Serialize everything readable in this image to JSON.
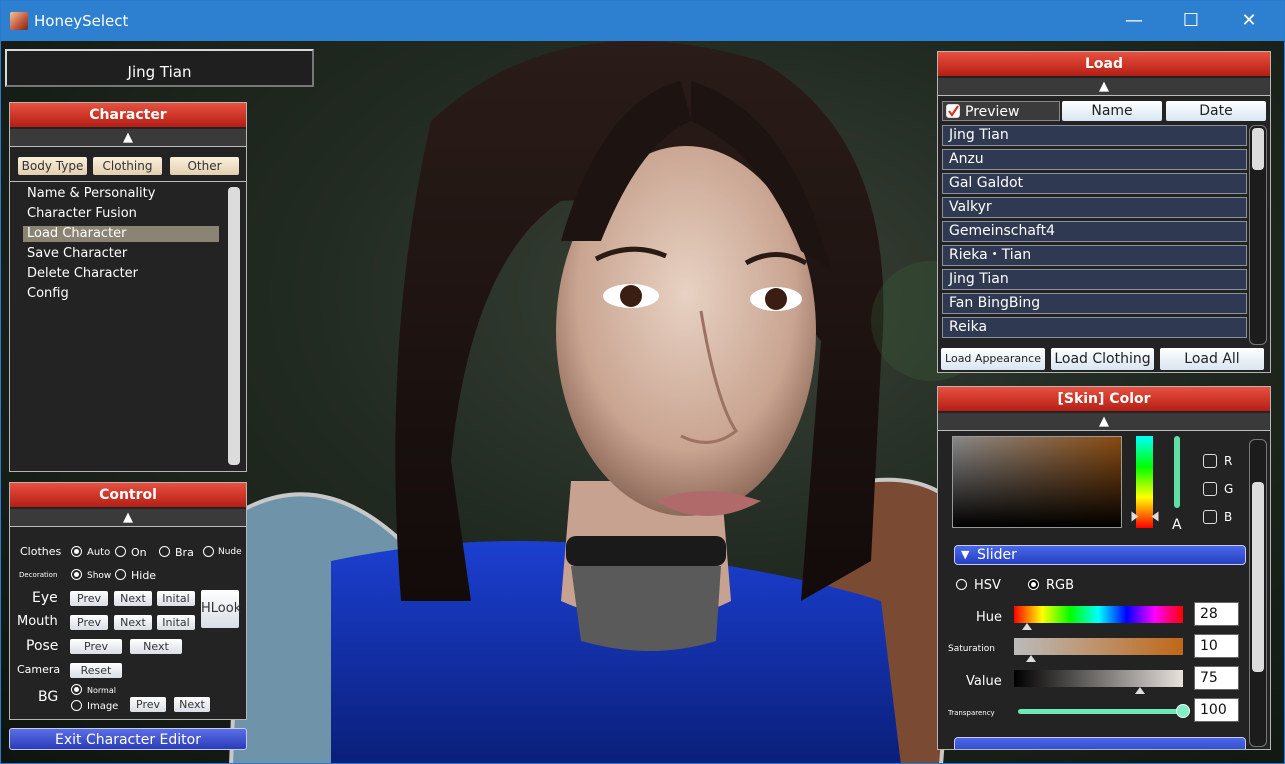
{
  "window": {
    "title": "HoneySelect",
    "minimize": "—",
    "maximize": "☐",
    "close": "✕"
  },
  "character_name": "Jing Tian",
  "character_panel": {
    "header": "Character",
    "collapse": "▲",
    "tabs": [
      "Body Type",
      "Clothing",
      "Other"
    ],
    "menu": [
      "Name & Personality",
      "Character Fusion",
      "Load Character",
      "Save Character",
      "Delete Character",
      "Config"
    ],
    "selected_index": 2
  },
  "control_panel": {
    "header": "Control",
    "collapse": "▲",
    "clothes": {
      "label": "Clothes",
      "options": [
        "Auto",
        "On",
        "Bra",
        "Nude"
      ],
      "selected": "Auto"
    },
    "decoration": {
      "label": "Decoration",
      "options": [
        "Show",
        "Hide"
      ],
      "selected": "Show"
    },
    "eye": {
      "label": "Eye",
      "prev": "Prev",
      "next": "Next",
      "init": "Inital"
    },
    "mouth": {
      "label": "Mouth",
      "prev": "Prev",
      "next": "Next",
      "init": "Inital"
    },
    "hlook": "HLook",
    "pose": {
      "label": "Pose",
      "prev": "Prev",
      "next": "Next"
    },
    "camera": {
      "label": "Camera",
      "reset": "Reset"
    },
    "bg": {
      "label": "BG",
      "options": [
        "Normal",
        "Image"
      ],
      "selected": "Normal",
      "prev": "Prev",
      "next": "Next"
    }
  },
  "exit_button": "Exit Character Editor",
  "load_panel": {
    "header": "Load",
    "collapse": "▲",
    "preview_label": "Preview",
    "preview_checked": true,
    "sort_buttons": [
      "Name",
      "Date"
    ],
    "items": [
      "Jing Tian",
      "Anzu",
      "Gal Galdot",
      "Valkyr",
      "Gemeinschaft4",
      "Rieka・Tian",
      "Jing Tian",
      " Fan BingBing",
      "Reika"
    ],
    "actions": [
      "Load Appearance",
      "Load Clothing",
      "Load All"
    ]
  },
  "color_panel": {
    "header": "[Skin] Color",
    "collapse": "▲",
    "channels": [
      "R",
      "G",
      "B"
    ],
    "alpha_label": "A",
    "slider_section": "Slider",
    "mode": {
      "options": [
        "HSV",
        "RGB"
      ],
      "selected": "RGB"
    },
    "sliders": [
      {
        "label": "Hue",
        "value": "28"
      },
      {
        "label": "Saturation",
        "value": "10"
      },
      {
        "label": "Value",
        "value": "75"
      },
      {
        "label": "Transparency",
        "value": "100"
      }
    ],
    "base_color": "#8a4a10"
  },
  "colors": {
    "header_red": "#d83a2c",
    "selected_item": "#8b8474",
    "accent_blue": "#3b5bd6",
    "titlebar": "#2d7fd0"
  }
}
